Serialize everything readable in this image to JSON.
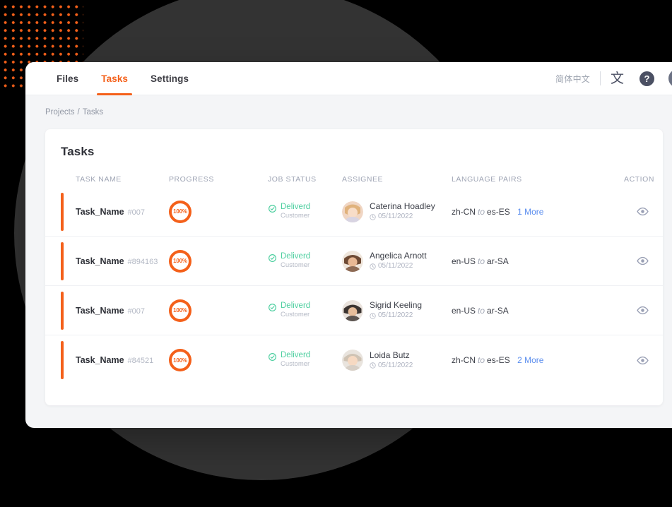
{
  "theme": {
    "accent": "#f4601a",
    "background": "#000000",
    "circle": "#333333",
    "status_green": "#4ecfa0",
    "link_blue": "#5a8dee",
    "window_bg": "#f4f5f7"
  },
  "topbar": {
    "tabs": [
      {
        "label": "Files",
        "active": false
      },
      {
        "label": "Tasks",
        "active": true
      },
      {
        "label": "Settings",
        "active": false
      }
    ],
    "language_label": "简体中文",
    "translate_glyph": "文",
    "help_glyph": "?",
    "icons": {
      "translate": "translate-icon",
      "help": "help-icon",
      "avatar": "user-avatar-icon"
    }
  },
  "breadcrumb": {
    "items": [
      "Projects",
      "Tasks"
    ],
    "separator": "/"
  },
  "card": {
    "title": "Tasks",
    "columns": [
      "TASK NAME",
      "PROGRESS",
      "JOB STATUS",
      "ASSIGNEE",
      "LANGUAGE PAIRS",
      "ACTION"
    ],
    "rows": [
      {
        "task_name": "Task_Name",
        "task_id": "#007",
        "progress_label": "100%",
        "progress_value": 100,
        "status": "Deliverd",
        "status_sub": "Customer",
        "assignee": "Caterina Hoadley",
        "date": "05/11/2022",
        "source_lang": "zh-CN",
        "to_label": "to",
        "target_lang": "es-ES",
        "more": "1 More",
        "action_icon": "eye-icon"
      },
      {
        "task_name": "Task_Name",
        "task_id": "#894163",
        "progress_label": "100%",
        "progress_value": 100,
        "status": "Deliverd",
        "status_sub": "Customer",
        "assignee": "Angelica Arnott",
        "date": "05/11/2022",
        "source_lang": "en-US",
        "to_label": "to",
        "target_lang": "ar-SA",
        "more": "",
        "action_icon": "eye-icon"
      },
      {
        "task_name": "Task_Name",
        "task_id": "#007",
        "progress_label": "100%",
        "progress_value": 100,
        "status": "Deliverd",
        "status_sub": "Customer",
        "assignee": "Sigrid Keeling",
        "date": "05/11/2022",
        "source_lang": "en-US",
        "to_label": "to",
        "target_lang": "ar-SA",
        "more": "",
        "action_icon": "eye-icon"
      },
      {
        "task_name": "Task_Name",
        "task_id": "#84521",
        "progress_label": "100%",
        "progress_value": 100,
        "status": "Deliverd",
        "status_sub": "Customer",
        "assignee": "Loida Butz",
        "date": "05/11/2022",
        "source_lang": "zh-CN",
        "to_label": "to",
        "target_lang": "es-ES",
        "more": "2 More",
        "action_icon": "eye-icon"
      }
    ]
  }
}
